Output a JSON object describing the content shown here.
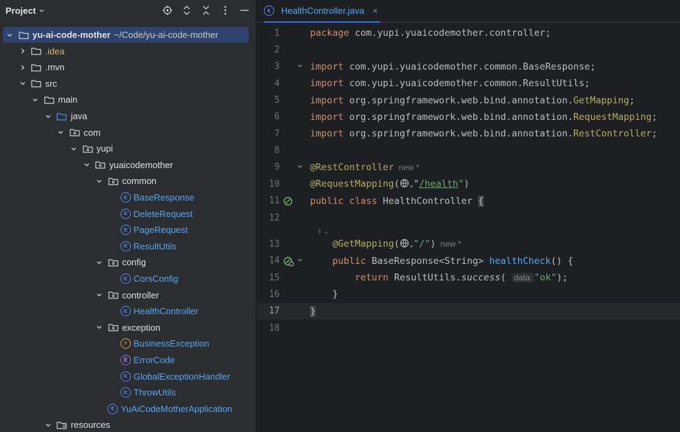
{
  "project_panel": {
    "title": "Project",
    "tree": [
      {
        "label": "yu-ai-code-mother",
        "path": "~/Code/yu-ai-code-mother",
        "kind": "root",
        "depth": 0,
        "expanded": true,
        "selected": true
      },
      {
        "label": ".idea",
        "kind": "folder",
        "depth": 1,
        "expanded": false,
        "style": "idea"
      },
      {
        "label": ".mvn",
        "kind": "folder",
        "depth": 1,
        "expanded": false
      },
      {
        "label": "src",
        "kind": "folder",
        "depth": 1,
        "expanded": true
      },
      {
        "label": "main",
        "kind": "folder",
        "depth": 2,
        "expanded": true
      },
      {
        "label": "java",
        "kind": "source-folder",
        "depth": 3,
        "expanded": true
      },
      {
        "label": "com",
        "kind": "package",
        "depth": 4,
        "expanded": true
      },
      {
        "label": "yupi",
        "kind": "package",
        "depth": 5,
        "expanded": true
      },
      {
        "label": "yuaicodemother",
        "kind": "package",
        "depth": 6,
        "expanded": true
      },
      {
        "label": "common",
        "kind": "package",
        "depth": 7,
        "expanded": true
      },
      {
        "label": "BaseResponse",
        "kind": "class",
        "depth": 8
      },
      {
        "label": "DeleteRequest",
        "kind": "class",
        "depth": 8
      },
      {
        "label": "PageRequest",
        "kind": "class",
        "depth": 8
      },
      {
        "label": "ResultUtils",
        "kind": "class",
        "depth": 8
      },
      {
        "label": "config",
        "kind": "package",
        "depth": 7,
        "expanded": true
      },
      {
        "label": "CorsConfig",
        "kind": "class",
        "depth": 8
      },
      {
        "label": "controller",
        "kind": "package",
        "depth": 7,
        "expanded": true
      },
      {
        "label": "HealthController",
        "kind": "class",
        "depth": 8
      },
      {
        "label": "exception",
        "kind": "package",
        "depth": 7,
        "expanded": true
      },
      {
        "label": "BusinessException",
        "kind": "exception",
        "depth": 8
      },
      {
        "label": "ErrorCode",
        "kind": "enum",
        "depth": 8
      },
      {
        "label": "GlobalExceptionHandler",
        "kind": "class",
        "depth": 8
      },
      {
        "label": "ThrowUtils",
        "kind": "class",
        "depth": 8
      },
      {
        "label": "YuAiCodeMotherApplication",
        "kind": "app-class",
        "depth": 7
      },
      {
        "label": "resources",
        "kind": "resources-folder",
        "depth": 3,
        "expanded": true
      }
    ]
  },
  "editor": {
    "tab": {
      "label": "HealthController.java",
      "close": "×"
    },
    "current_line": 17,
    "lines": [
      {
        "n": "1",
        "tokens": [
          [
            "kw",
            "package "
          ],
          [
            "",
            "com.yupi.yuaicodemother.controller;"
          ]
        ]
      },
      {
        "n": "2",
        "tokens": []
      },
      {
        "n": "3",
        "fold": true,
        "tokens": [
          [
            "kw",
            "import "
          ],
          [
            "",
            "com.yupi.yuaicodemother.common.BaseResponse;"
          ]
        ]
      },
      {
        "n": "4",
        "tokens": [
          [
            "kw",
            "import "
          ],
          [
            "",
            "com.yupi.yuaicodemother.common.ResultUtils;"
          ]
        ]
      },
      {
        "n": "5",
        "tokens": [
          [
            "kw",
            "import "
          ],
          [
            "",
            "org.springframework.web.bind.annotation."
          ],
          [
            "ref",
            "GetMapping"
          ],
          [
            "",
            ";"
          ]
        ]
      },
      {
        "n": "6",
        "tokens": [
          [
            "kw",
            "import "
          ],
          [
            "",
            "org.springframework.web.bind.annotation."
          ],
          [
            "ref",
            "RequestMapping"
          ],
          [
            "",
            ";"
          ]
        ]
      },
      {
        "n": "7",
        "tokens": [
          [
            "kw",
            "import "
          ],
          [
            "",
            "org.springframework.web.bind.annotation."
          ],
          [
            "ref",
            "RestController"
          ],
          [
            "",
            ";"
          ]
        ]
      },
      {
        "n": "8",
        "tokens": []
      },
      {
        "n": "9",
        "fold": true,
        "tokens": [
          [
            "ann",
            "@RestController"
          ],
          [
            "hint",
            "  new *"
          ]
        ]
      },
      {
        "n": "10",
        "tokens": [
          [
            "ann",
            "@RequestMapping"
          ],
          [
            "",
            "("
          ],
          [
            "globe",
            ""
          ],
          [
            "",
            "\""
          ],
          [
            "strlink",
            "/health"
          ],
          [
            "str",
            "\""
          ],
          [
            "",
            ")"
          ]
        ]
      },
      {
        "n": "11",
        "gutter": "bean",
        "tokens": [
          [
            "kw",
            "public class "
          ],
          [
            "",
            "HealthController "
          ],
          [
            "brace",
            "{"
          ]
        ]
      },
      {
        "n": "12",
        "tokens": []
      },
      {
        "n": "",
        "inlay": true,
        "tokens": [
          [
            "small",
            "    ⚕ ⌄"
          ]
        ]
      },
      {
        "n": "13",
        "tokens": [
          [
            "",
            "    "
          ],
          [
            "ann",
            "@GetMapping"
          ],
          [
            "",
            "("
          ],
          [
            "globe",
            ""
          ],
          [
            "str",
            "\"/\""
          ],
          [
            "",
            ")"
          ],
          [
            "hint",
            "  new *"
          ]
        ]
      },
      {
        "n": "14",
        "gutter": "bean-web",
        "fold": true,
        "tokens": [
          [
            "",
            "    "
          ],
          [
            "kw",
            "public "
          ],
          [
            "",
            "BaseResponse<String> "
          ],
          [
            "fn",
            "healthCheck"
          ],
          [
            "",
            "() {"
          ]
        ]
      },
      {
        "n": "15",
        "tokens": [
          [
            "",
            "        "
          ],
          [
            "kw",
            "return "
          ],
          [
            "",
            "ResultUtils."
          ],
          [
            "it",
            "success"
          ],
          [
            "",
            "( "
          ],
          [
            "param",
            "data:"
          ],
          [
            "str",
            "\"ok\""
          ],
          [
            "",
            ");"
          ]
        ]
      },
      {
        "n": "16",
        "tokens": [
          [
            "",
            "    }"
          ]
        ]
      },
      {
        "n": "17",
        "tokens": [
          [
            "brace",
            "}"
          ]
        ]
      },
      {
        "n": "18",
        "tokens": []
      }
    ]
  },
  "colors": {
    "accent": "#3574f0",
    "keyword": "#cf8e6d",
    "annotation": "#b3ae60",
    "string": "#6aab73",
    "function": "#56a8f5",
    "class_label": "#57a8f5"
  }
}
